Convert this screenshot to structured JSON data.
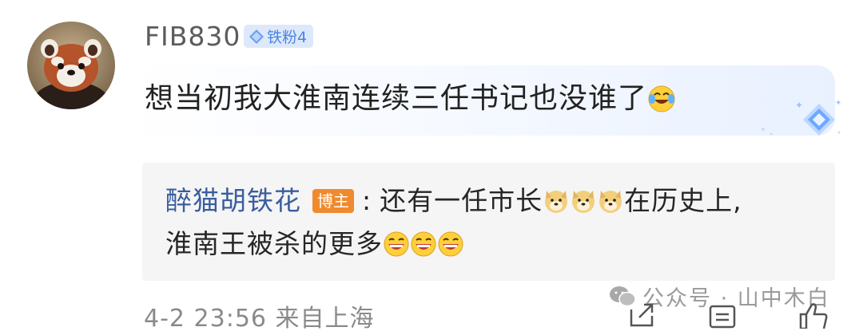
{
  "comment": {
    "username": "FIB830",
    "fan_badge": "铁粉4",
    "text": "想当初我大淮南连续三任书记也没谁了",
    "emoji": "laughing-crying-icon",
    "meta": "4-2 23:56 来自上海"
  },
  "reply": {
    "username": "醉猫胡铁花",
    "host_badge": "博主",
    "separator": ":",
    "line1_a": "还有一任市长",
    "line1_b": "在历史上,",
    "line2": "淮南王被杀的更多",
    "emoji_line1": "doge-icon",
    "emoji_line2": "grinning-tears-icon"
  },
  "watermark": {
    "text": "公众号 · 山中木白"
  },
  "colors": {
    "reply_user": "#3a5d9e",
    "host_badge": "#f08a2e",
    "fan_badge_bg": "#dde9fb",
    "fan_badge_text": "#4d83e4"
  }
}
